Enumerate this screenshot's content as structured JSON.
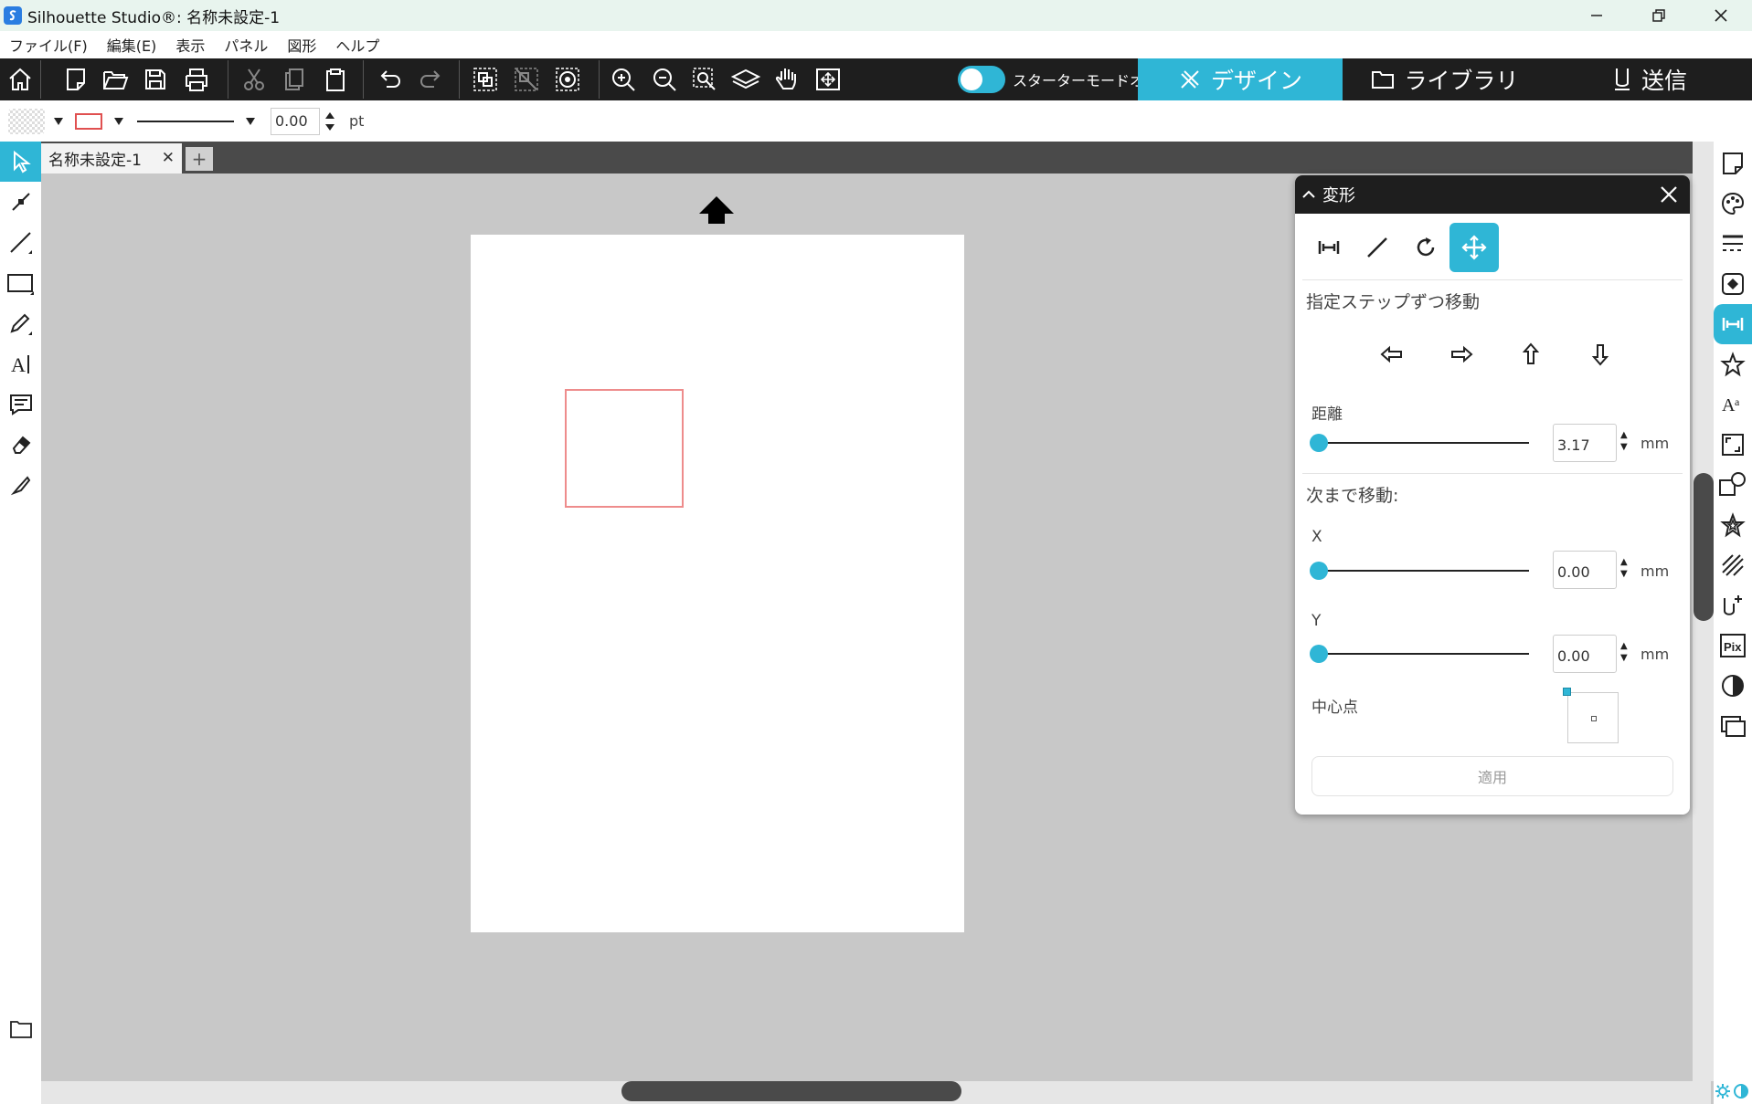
{
  "window": {
    "title": "Silhouette Studio®: 名称未設定-1"
  },
  "menu": {
    "items": [
      "ファイル(F)",
      "編集(E)",
      "表示",
      "パネル",
      "図形",
      "ヘルプ"
    ]
  },
  "toolbar": {
    "icons": [
      "home-icon",
      "new-document-icon",
      "open-folder-icon",
      "save-icon",
      "print-icon",
      "cut-icon",
      "copy-icon",
      "paste-icon",
      "undo-icon",
      "redo-icon",
      "group-icon",
      "ungroup-icon",
      "compound-path-icon",
      "zoom-in-icon",
      "zoom-out-icon",
      "zoom-select-icon",
      "fit-to-page-icon",
      "pan-hand-icon",
      "fit-window-icon"
    ],
    "starter_mode_label": "スターターモードオフ"
  },
  "nav_tabs": [
    {
      "label": "デザイン",
      "icon": "design-icon",
      "active": true
    },
    {
      "label": "ライブラリ",
      "icon": "library-folder-icon",
      "active": false
    },
    {
      "label": "送信",
      "icon": "send-icon",
      "active": false
    }
  ],
  "properties": {
    "stroke_width": "0.00",
    "stroke_unit": "pt",
    "fill_icon": "fill-pattern-icon",
    "line_color": "#e05050"
  },
  "documents": {
    "tabs": [
      {
        "label": "名称未設定-1"
      }
    ],
    "add_label": "+"
  },
  "left_tools": [
    "select-icon",
    "point-edit-icon",
    "line-tool-icon",
    "rectangle-tool-icon",
    "pencil-tool-icon",
    "text-tool-icon",
    "text-box-icon",
    "eraser-icon",
    "knife-icon"
  ],
  "right_panels": [
    "page-setup-icon",
    "color-palette-icon",
    "line-style-icon",
    "fill-icon",
    "transform-icon",
    "replicate-icon",
    "text-style-icon",
    "scale-icon",
    "modify-icon",
    "offset-star-icon",
    "trace-icon",
    "point-icon",
    "pixscan-icon",
    "contrast-icon",
    "library-panel-icon"
  ],
  "transform_panel": {
    "title": "変形",
    "tabs": [
      "align-icon",
      "scale-icon",
      "rotate-icon",
      "move-icon"
    ],
    "active_tab": 3,
    "step_move_label": "指定ステップずつ移動",
    "step_arrows": [
      "arrow-left-icon",
      "arrow-right-icon",
      "arrow-up-icon",
      "arrow-down-icon"
    ],
    "distance_label": "距離",
    "distance_value": "3.17",
    "distance_unit": "mm",
    "move_to_label": "次まで移動:",
    "x_label": "X",
    "x_value": "0.00",
    "x_unit": "mm",
    "y_label": "Y",
    "y_value": "0.00",
    "y_unit": "mm",
    "center_label": "中心点",
    "apply_label": "適用"
  },
  "colors": {
    "accent": "#2fb6d6",
    "toolbar_bg": "#1e1e1e",
    "canvas_bg": "#c8c8c8",
    "shape_stroke": "#ee8c8c"
  }
}
